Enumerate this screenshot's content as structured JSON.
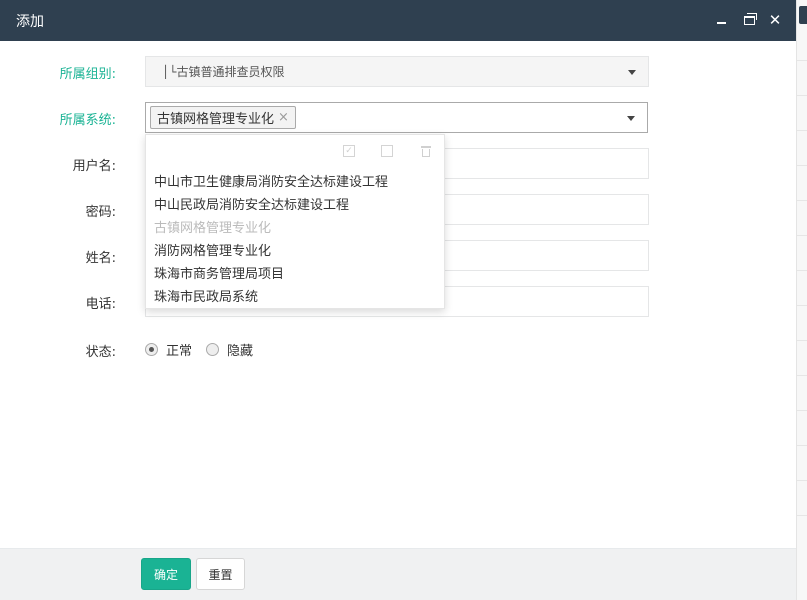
{
  "window": {
    "title": "添加",
    "min_icon": "minimize-icon",
    "max_icon": "restore-icon",
    "close_icon": "close-icon",
    "close_glyph": "✕",
    "titlebar_color": "#2f4050"
  },
  "form": {
    "group": {
      "label": "所属组别:",
      "value": "│└古镇普通排查员权限"
    },
    "system": {
      "label": "所属系统:",
      "selected_chip": "古镇网格管理专业化",
      "chip_remove": "×"
    },
    "username": {
      "label": "用户名:",
      "value": ""
    },
    "password": {
      "label": "密码:",
      "value": ""
    },
    "realname": {
      "label": "姓名:",
      "value": ""
    },
    "phone": {
      "label": "电话:",
      "value": ""
    },
    "status": {
      "label": "状态:",
      "options": [
        {
          "label": "正常",
          "checked": true
        },
        {
          "label": "隐藏",
          "checked": false
        }
      ]
    }
  },
  "dropdown": {
    "tools": [
      "check-all-icon",
      "uncheck-all-icon",
      "trash-icon"
    ],
    "options": [
      {
        "label": "中山市卫生健康局消防安全达标建设工程",
        "selected": false
      },
      {
        "label": "中山民政局消防安全达标建设工程",
        "selected": false
      },
      {
        "label": "古镇网格管理专业化",
        "selected": true
      },
      {
        "label": "消防网格管理专业化",
        "selected": false
      },
      {
        "label": "珠海市商务管理局项目",
        "selected": false
      },
      {
        "label": "珠海市民政局系统",
        "selected": false
      }
    ]
  },
  "footer": {
    "confirm_label": "确定",
    "reset_label": "重置"
  },
  "colors": {
    "accent": "#1ab394",
    "titlebar": "#2f4050"
  }
}
